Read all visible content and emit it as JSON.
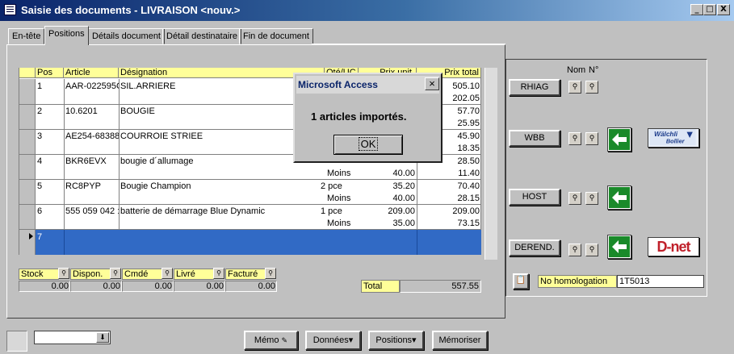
{
  "window": {
    "title": "Saisie des documents - LIVRAISON <nouv.>",
    "min": "_",
    "max": "□",
    "close": "X"
  },
  "tabs": [
    "En-tête",
    "Positions",
    "Détails document",
    "Détail destinataire",
    "Fin de document"
  ],
  "grid": {
    "headers": {
      "pos": "Pos",
      "article": "Article",
      "designation": "Désignation",
      "qte": "Qté/UC",
      "prix_unit": "Prix unit.",
      "prix_total": "Prix total"
    },
    "rows": [
      {
        "pos": "1",
        "article": "AAR-022595C",
        "designation": "SIL.ARRIERE",
        "qte": "",
        "prix_unit": "",
        "prix_total": "505.10",
        "moins": "",
        "moins_unit": "",
        "moins_total": "202.05"
      },
      {
        "pos": "2",
        "article": "10.6201",
        "designation": "BOUGIE",
        "qte": "",
        "prix_unit": "",
        "prix_total": "57.70",
        "moins": "",
        "moins_unit": "",
        "moins_total": "25.95"
      },
      {
        "pos": "3",
        "article": "AE254-68388",
        "designation": "COURROIE STRIEE",
        "qte": "",
        "prix_unit": "",
        "prix_total": "45.90",
        "moins": "",
        "moins_unit": "",
        "moins_total": "18.35"
      },
      {
        "pos": "4",
        "article": "BKR6EVX",
        "designation": "bougie d´allumage",
        "qte": "",
        "prix_unit": "",
        "prix_total": "28.50",
        "moins": "Moins",
        "moins_unit": "40.00",
        "moins_total": "11.40"
      },
      {
        "pos": "5",
        "article": "RC8PYP",
        "designation": "Bougie Champion",
        "qte": "2 pce",
        "prix_unit": "35.20",
        "prix_total": "70.40",
        "moins": "Moins",
        "moins_unit": "40.00",
        "moins_total": "28.15"
      },
      {
        "pos": "6",
        "article": "555 059 042 :",
        "designation": "batterie de démarrage Blue Dynamic",
        "qte": "1 pce",
        "prix_unit": "209.00",
        "prix_total": "209.00",
        "moins": "Moins",
        "moins_unit": "35.00",
        "moins_total": "73.15"
      }
    ],
    "new_row_pos": "7"
  },
  "stock": {
    "labels": [
      "Stock",
      "Dispon.",
      "Cmdé",
      "Livré",
      "Facturé"
    ],
    "values": [
      "0.00",
      "0.00",
      "0.00",
      "0.00",
      "0.00"
    ]
  },
  "total": {
    "label": "Total",
    "value": "557.55"
  },
  "right_panel": {
    "col_nom": "Nom",
    "col_num": "N°",
    "suppliers": [
      "RHIAG",
      "WBB",
      "HOST",
      "DEREND."
    ],
    "logo_walchli": "Wälchli Bollier",
    "logo_dnet": "D-net",
    "homologation_label": "No homologation",
    "homologation_value": "1T5013"
  },
  "dialog": {
    "title": "Microsoft Access",
    "message": "1 articles importés.",
    "ok": "OK",
    "close": "×"
  },
  "footer": {
    "combo_value": "",
    "memo": "Mémo",
    "donnees": "Données▾",
    "positions": "Positions▾",
    "memoriser": "Mémoriser"
  }
}
